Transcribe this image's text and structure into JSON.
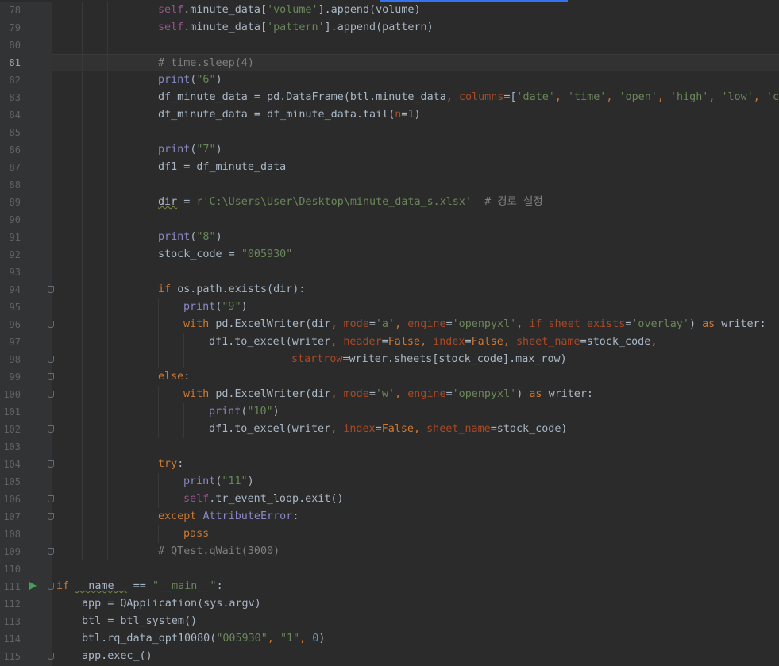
{
  "editor": {
    "first_line_number": 78,
    "current_line": 81,
    "run_marker_line": 111,
    "fold_marker_lines": [
      94,
      96,
      98,
      99,
      100,
      102,
      104,
      106,
      107,
      109,
      111,
      115
    ],
    "lines": [
      {
        "indent": 4,
        "tokens": [
          [
            "self",
            "self"
          ],
          [
            ".minute_data[",
            ""
          ],
          [
            "'volume'",
            "str"
          ],
          [
            "].append(volume)",
            ""
          ]
        ]
      },
      {
        "indent": 4,
        "tokens": [
          [
            "self",
            "self"
          ],
          [
            ".minute_data[",
            ""
          ],
          [
            "'pattern'",
            "str"
          ],
          [
            "].append(pattern)",
            ""
          ]
        ]
      },
      {
        "indent": 4,
        "tokens": []
      },
      {
        "indent": 4,
        "tokens": [
          [
            "# time.sleep(4)",
            "cmt"
          ]
        ]
      },
      {
        "indent": 4,
        "tokens": [
          [
            "print",
            "builtin"
          ],
          [
            "(",
            ""
          ],
          [
            "\"6\"",
            "str"
          ],
          [
            ")",
            ""
          ]
        ]
      },
      {
        "indent": 4,
        "tokens": [
          [
            "df_minute_data = pd.DataFrame(btl.minute_data",
            ""
          ],
          [
            ", ",
            "kw"
          ],
          [
            "columns",
            "param"
          ],
          [
            "=[",
            ""
          ],
          [
            "'date'",
            "str"
          ],
          [
            ", ",
            "kw"
          ],
          [
            "'time'",
            "str"
          ],
          [
            ", ",
            "kw"
          ],
          [
            "'open'",
            "str"
          ],
          [
            ", ",
            "kw"
          ],
          [
            "'high'",
            "str"
          ],
          [
            ", ",
            "kw"
          ],
          [
            "'low'",
            "str"
          ],
          [
            ", ",
            "kw"
          ],
          [
            "'cl",
            "str"
          ]
        ]
      },
      {
        "indent": 4,
        "tokens": [
          [
            "df_minute_data = df_minute_data.tail(",
            ""
          ],
          [
            "n",
            "param"
          ],
          [
            "=",
            ""
          ],
          [
            "1",
            "num"
          ],
          [
            ")",
            ""
          ]
        ]
      },
      {
        "indent": 4,
        "tokens": []
      },
      {
        "indent": 4,
        "tokens": [
          [
            "print",
            "builtin"
          ],
          [
            "(",
            ""
          ],
          [
            "\"7\"",
            "str"
          ],
          [
            ")",
            ""
          ]
        ]
      },
      {
        "indent": 4,
        "tokens": [
          [
            "df1 = df_minute_data",
            ""
          ]
        ]
      },
      {
        "indent": 4,
        "tokens": []
      },
      {
        "indent": 4,
        "tokens": [
          [
            "dir",
            "wavy"
          ],
          [
            " = ",
            ""
          ],
          [
            "r'C:\\Users\\User\\Desktop\\minute_data_s.xlsx'",
            "str"
          ],
          [
            "  ",
            ""
          ],
          [
            "# 경로 설정",
            "cmt"
          ]
        ]
      },
      {
        "indent": 4,
        "tokens": []
      },
      {
        "indent": 4,
        "tokens": [
          [
            "print",
            "builtin"
          ],
          [
            "(",
            ""
          ],
          [
            "\"8\"",
            "str"
          ],
          [
            ")",
            ""
          ]
        ]
      },
      {
        "indent": 4,
        "tokens": [
          [
            "stock_code = ",
            ""
          ],
          [
            "\"005930\"",
            "str"
          ]
        ]
      },
      {
        "indent": 4,
        "tokens": []
      },
      {
        "indent": 4,
        "tokens": [
          [
            "if ",
            "kw"
          ],
          [
            "os.path.exists(dir):",
            ""
          ]
        ]
      },
      {
        "indent": 5,
        "tokens": [
          [
            "print",
            "builtin"
          ],
          [
            "(",
            ""
          ],
          [
            "\"9\"",
            "str"
          ],
          [
            ")",
            ""
          ]
        ]
      },
      {
        "indent": 5,
        "tokens": [
          [
            "with ",
            "kw"
          ],
          [
            "pd.ExcelWriter(dir",
            ""
          ],
          [
            ", ",
            "kw"
          ],
          [
            "mode",
            "param"
          ],
          [
            "=",
            ""
          ],
          [
            "'a'",
            "str"
          ],
          [
            ", ",
            "kw"
          ],
          [
            "engine",
            "param"
          ],
          [
            "=",
            ""
          ],
          [
            "'openpyxl'",
            "str"
          ],
          [
            ", ",
            "kw"
          ],
          [
            "if_sheet_exists",
            "param"
          ],
          [
            "=",
            ""
          ],
          [
            "'overlay'",
            "str"
          ],
          [
            ") ",
            ""
          ],
          [
            "as ",
            "kw"
          ],
          [
            "writer:",
            ""
          ]
        ]
      },
      {
        "indent": 6,
        "tokens": [
          [
            "df1.to_excel(writer",
            ""
          ],
          [
            ", ",
            "kw"
          ],
          [
            "header",
            "param"
          ],
          [
            "=",
            ""
          ],
          [
            "False",
            "kw"
          ],
          [
            ", ",
            "kw"
          ],
          [
            "index",
            "param"
          ],
          [
            "=",
            ""
          ],
          [
            "False",
            "kw"
          ],
          [
            ", ",
            "kw"
          ],
          [
            "sheet_name",
            "param"
          ],
          [
            "=stock_code",
            ""
          ],
          [
            ",",
            "kw"
          ]
        ]
      },
      {
        "indent": 9.25,
        "tokens": [
          [
            "startrow",
            "param"
          ],
          [
            "=writer.sheets[stock_code].max_row)",
            ""
          ]
        ]
      },
      {
        "indent": 4,
        "tokens": [
          [
            "else",
            "kw"
          ],
          [
            ":",
            ""
          ]
        ]
      },
      {
        "indent": 5,
        "tokens": [
          [
            "with ",
            "kw"
          ],
          [
            "pd.ExcelWriter(dir",
            ""
          ],
          [
            ", ",
            "kw"
          ],
          [
            "mode",
            "param"
          ],
          [
            "=",
            ""
          ],
          [
            "'w'",
            "str"
          ],
          [
            ", ",
            "kw"
          ],
          [
            "engine",
            "param"
          ],
          [
            "=",
            ""
          ],
          [
            "'openpyxl'",
            "str"
          ],
          [
            ") ",
            ""
          ],
          [
            "as ",
            "kw"
          ],
          [
            "writer:",
            ""
          ]
        ]
      },
      {
        "indent": 6,
        "tokens": [
          [
            "print",
            "builtin"
          ],
          [
            "(",
            ""
          ],
          [
            "\"10\"",
            "str"
          ],
          [
            ")",
            ""
          ]
        ]
      },
      {
        "indent": 6,
        "tokens": [
          [
            "df1.to_excel(writer",
            ""
          ],
          [
            ", ",
            "kw"
          ],
          [
            "index",
            "param"
          ],
          [
            "=",
            ""
          ],
          [
            "False",
            "kw"
          ],
          [
            ", ",
            "kw"
          ],
          [
            "sheet_name",
            "param"
          ],
          [
            "=stock_code)",
            ""
          ]
        ]
      },
      {
        "indent": 4,
        "tokens": []
      },
      {
        "indent": 4,
        "tokens": [
          [
            "try",
            "kw"
          ],
          [
            ":",
            ""
          ]
        ]
      },
      {
        "indent": 5,
        "tokens": [
          [
            "print",
            "builtin"
          ],
          [
            "(",
            ""
          ],
          [
            "\"11\"",
            "str"
          ],
          [
            ")",
            ""
          ]
        ]
      },
      {
        "indent": 5,
        "tokens": [
          [
            "self",
            "self"
          ],
          [
            ".tr_event_loop.exit()",
            ""
          ]
        ]
      },
      {
        "indent": 4,
        "tokens": [
          [
            "except ",
            "kw"
          ],
          [
            "AttributeError",
            "cls"
          ],
          [
            ":",
            ""
          ]
        ]
      },
      {
        "indent": 5,
        "tokens": [
          [
            "pass",
            "kw"
          ]
        ]
      },
      {
        "indent": 4,
        "tokens": [
          [
            "# QTest.qWait(3000)",
            "cmt"
          ]
        ]
      },
      {
        "indent": 0,
        "tokens": []
      },
      {
        "indent": 0,
        "tokens": [
          [
            "if ",
            "kw"
          ],
          [
            "__name__",
            "wavy"
          ],
          [
            " == ",
            ""
          ],
          [
            "\"__main__\"",
            "str"
          ],
          [
            ":",
            ""
          ]
        ]
      },
      {
        "indent": 1,
        "tokens": [
          [
            "app = QApplication(sys.argv)",
            ""
          ]
        ]
      },
      {
        "indent": 1,
        "tokens": [
          [
            "btl = btl_system()",
            ""
          ]
        ]
      },
      {
        "indent": 1,
        "tokens": [
          [
            "btl.rq_data_opt10080(",
            ""
          ],
          [
            "\"005930\"",
            "str"
          ],
          [
            ", ",
            "kw"
          ],
          [
            "\"1\"",
            "str"
          ],
          [
            ", ",
            "kw"
          ],
          [
            "0",
            "num"
          ],
          [
            ")",
            ""
          ]
        ]
      },
      {
        "indent": 1,
        "tokens": [
          [
            "app.exec_()",
            ""
          ]
        ]
      }
    ]
  }
}
